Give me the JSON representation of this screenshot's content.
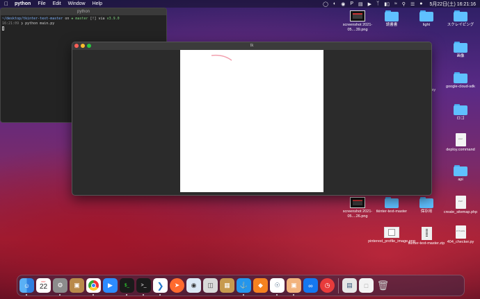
{
  "menubar": {
    "app_name": "python",
    "items": [
      "File",
      "Edit",
      "Window",
      "Help"
    ],
    "clock": "5月22日(土) 16:21:16"
  },
  "terminal": {
    "title": "python",
    "line1_dir": "~/desktop/tkinter-text-master",
    "line1_on": "on",
    "line1_branch": "master",
    "line1_status": "[!] via",
    "line1_py": "v3.9.0",
    "line2_time": "16:21:09",
    "line2_cmd": "python main.py"
  },
  "tk_window": {
    "title": "tk"
  },
  "desktop_icons": [
    {
      "label": "screenshot 2021-05....39.png",
      "kind": "thumb"
    },
    {
      "label": "読書書",
      "kind": "folder"
    },
    {
      "label": "light",
      "kind": "folder"
    },
    {
      "label": "スクレイピング",
      "kind": "folder"
    },
    {
      "label": "画像",
      "kind": "folder"
    },
    {
      "label": "roxy",
      "kind": "text"
    },
    {
      "label": "google-cloud-sdk",
      "kind": "folder"
    },
    {
      "label": "ロゴ",
      "kind": "folder"
    },
    {
      "label": "deploy.command",
      "kind": "file"
    },
    {
      "label": "api",
      "kind": "folder"
    },
    {
      "label": "screenshot 2021-05....26.png",
      "kind": "thumb"
    },
    {
      "label": "tkinter-text-master",
      "kind": "folder"
    },
    {
      "label": "保存用",
      "kind": "folder"
    },
    {
      "label": "create_sitemap.php",
      "kind": "file"
    },
    {
      "label": "pinterest_profile_image.png",
      "kind": "thumb-light"
    },
    {
      "label": "tkinter-text-master.zip",
      "kind": "zip"
    },
    {
      "label": "404_checker.py",
      "kind": "file"
    }
  ],
  "file_tags": {
    "deploy": "exec",
    "php": "PHP",
    "py": "PYTHON"
  },
  "dock": {
    "calendar_day": "22",
    "calendar_month": "MAY"
  }
}
